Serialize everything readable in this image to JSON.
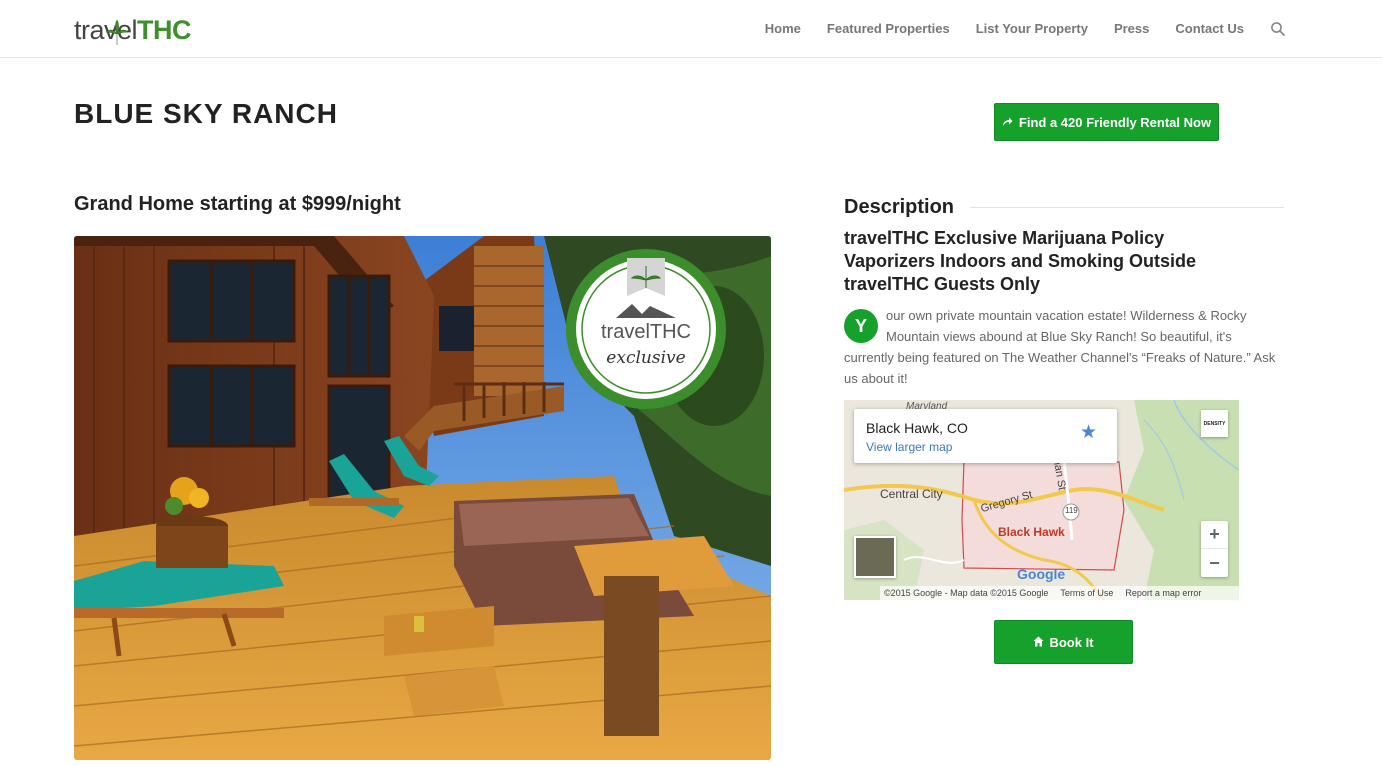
{
  "header": {
    "logo_travel": "travel",
    "logo_thc": "THC",
    "nav": [
      {
        "label": "Home"
      },
      {
        "label": "Featured Properties"
      },
      {
        "label": "List Your Property"
      },
      {
        "label": "Press"
      },
      {
        "label": "Contact Us"
      }
    ]
  },
  "page": {
    "title": "BLUE SKY RANCH",
    "cta_label": "Find a 420 Friendly Rental Now",
    "subtitle": "Grand Home starting at $999/night"
  },
  "photo": {
    "badge_brand": "travelTHC",
    "badge_tag": "exclusive"
  },
  "description": {
    "heading": "Description",
    "lines": [
      "travelTHC Exclusive Marijuana Policy",
      "Vaporizers Indoors and Smoking Outside",
      "travelTHC Guests Only"
    ],
    "dropcap": "Y",
    "body": "our own private mountain vacation estate! Wilderness & Rocky Mountain views abound at Blue Sky Ranch! So beautiful, it's currently being featured on The Weather Channel's “Freaks of Nature.” Ask us about it!"
  },
  "map": {
    "place": "Black Hawk, CO",
    "link": "View larger map",
    "labels": {
      "maryland": "Maryland",
      "central_city": "Central City",
      "gregory_st": "Gregory St",
      "black_hawk": "Black Hawk",
      "chapman_st": "hman St",
      "route": "119",
      "google": "Google"
    },
    "badge": "DENSITY",
    "zoom_in": "+",
    "zoom_out": "−",
    "footer": {
      "attribution": "©2015 Google - Map data ©2015 Google",
      "terms": "Terms of Use",
      "report": "Report a map error"
    }
  },
  "book": {
    "label": "Book It"
  },
  "colors": {
    "accent_green": "#16a02c",
    "logo_green": "#3f8f2e",
    "link_blue": "#3a78c3"
  }
}
